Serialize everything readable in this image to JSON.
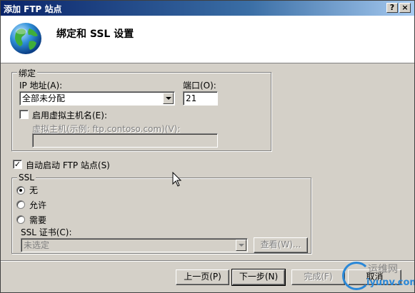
{
  "window": {
    "title": "添加 FTP 站点",
    "help_label": "?",
    "close_label": "×"
  },
  "header": {
    "title": "绑定和 SSL 设置"
  },
  "binding": {
    "legend": "绑定",
    "ip_label": "IP 地址(A):",
    "ip_value": "全部未分配",
    "port_label": "端口(O):",
    "port_value": "21",
    "vhost_label": "启用虚拟主机名(E):",
    "vhost_checked": false,
    "vhost_field_label": "虚拟主机(示例: ftp.contoso.com)(V):",
    "vhost_value": ""
  },
  "autostart": {
    "label": "自动启动 FTP 站点(S)",
    "checked": true
  },
  "ssl": {
    "legend": "SSL",
    "options": [
      "无",
      "允许",
      "需要"
    ],
    "selected": "无",
    "cert_label": "SSL 证书(C):",
    "cert_value": "未选定",
    "view_label": "查看(W)..."
  },
  "footer": {
    "prev_label": "上一页(P)",
    "next_label": "下一步(N)",
    "finish_label": "完成(F)",
    "cancel_label": "取消"
  },
  "watermark": {
    "top_text": "运维网",
    "bottom_text": "iyunv.com"
  },
  "icons": {
    "globe": "globe-icon",
    "cursor": "mouse-cursor-icon"
  },
  "colors": {
    "dialog_bg": "#d4d0c8",
    "titlebar": "#0a246a",
    "header_bg": "#ffffff",
    "watermark_blue": "#2a88d8"
  }
}
